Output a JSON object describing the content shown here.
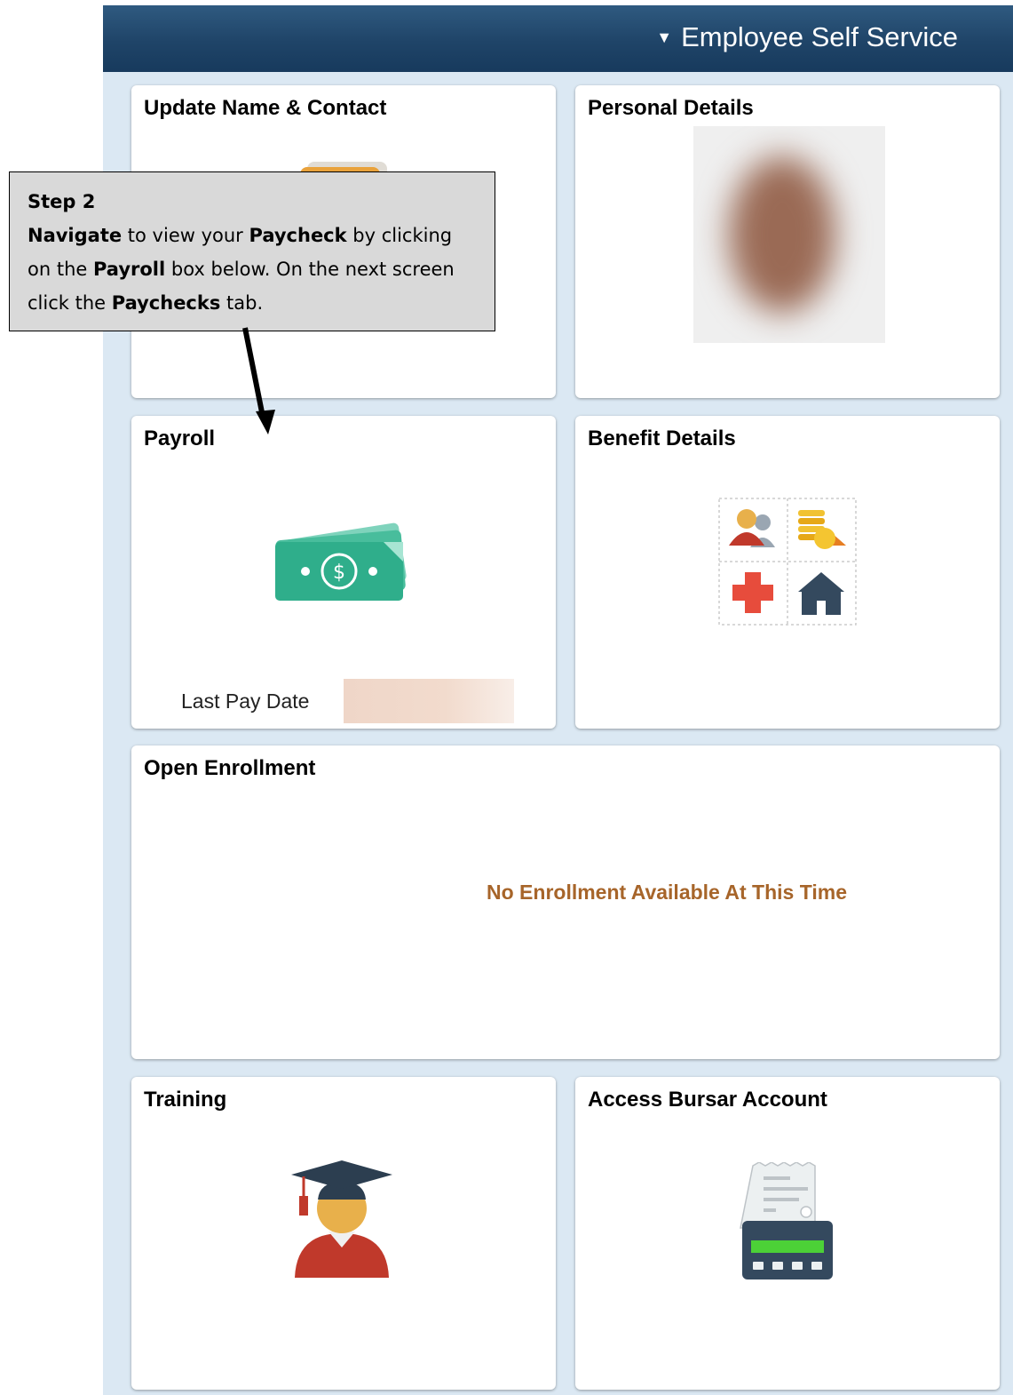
{
  "header": {
    "nav_label": "Employee Self Service",
    "nav_caret": "▼",
    "background_color": "#1f4468"
  },
  "tiles": {
    "update_name": {
      "title": "Update Name & Contact",
      "icon": "contact-card-icon"
    },
    "personal_details": {
      "title": "Personal Details",
      "icon": "profile-photo"
    },
    "payroll": {
      "title": "Payroll",
      "icon": "money-icon",
      "last_pay_label": "Last Pay Date",
      "last_pay_value": ""
    },
    "benefit_details": {
      "title": "Benefit Details",
      "icon": "benefits-grid-icon"
    },
    "open_enrollment": {
      "title": "Open Enrollment",
      "message": "No Enrollment Available At This Time",
      "message_color": "#a7652a"
    },
    "training": {
      "title": "Training",
      "icon": "graduate-icon"
    },
    "bursar": {
      "title": "Access Bursar Account",
      "icon": "register-receipt-icon"
    }
  },
  "callout": {
    "heading": "Step 2",
    "w1": "Navigate",
    "t1": " to view your ",
    "w2": "Paycheck",
    "t2": " by clicking on the ",
    "w3": "Payroll",
    "t3": " box below. On the next screen click the ",
    "w4": "Paychecks",
    "t4": " tab."
  },
  "colors": {
    "page_background": "#dbe8f3",
    "money_green": "#2fae8b",
    "graduate_robe": "#c0392b"
  }
}
